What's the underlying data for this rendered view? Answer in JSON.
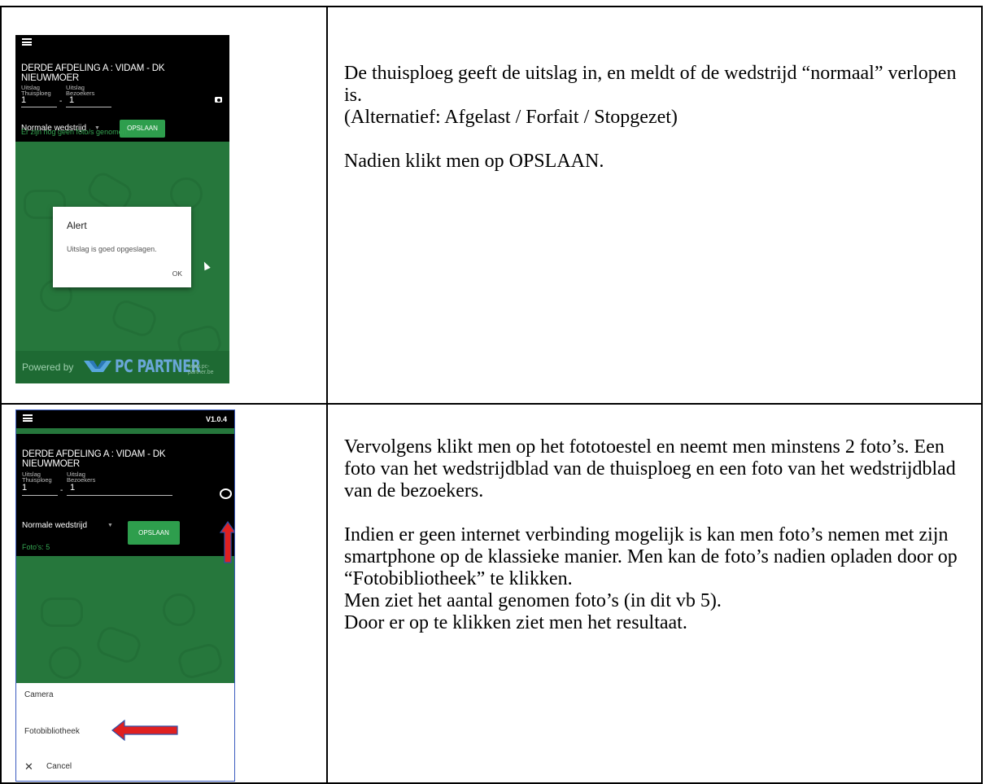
{
  "rows": [
    {
      "phone": {
        "league_title": "DERDE AFDELING A : VIDAM - DK NIEUWMOER",
        "score_label": "Uitslag",
        "home_label": "Thuisploeg",
        "away_label": "Bezoekers",
        "home_score": "1",
        "away_score": "1",
        "dash": "-",
        "match_type": "Normale wedstrijd",
        "save_label": "OPSLAAN",
        "photo_info": "Er zijn nog geen foto/s genomen",
        "alert": {
          "title": "Alert",
          "message": "Uitslag is goed opgeslagen.",
          "ok": "OK"
        },
        "footer": {
          "powered_by": "Powered by",
          "brand": "PC PARTNER",
          "url": "www.pc-partner.be"
        }
      },
      "text": {
        "line1": "De thuisploeg geeft de uitslag in, en meldt of de wedstrijd “normaal” verlopen is.",
        "line2": "(Alternatief: Afgelast / Forfait / Stopgezet)",
        "line3": "Nadien klikt men op OPSLAAN."
      }
    },
    {
      "phone": {
        "version": "V1.0.4",
        "league_title_1": "DERDE AFDELING A : VIDAM - DK",
        "league_title_2": "NIEUWMOER",
        "score_label": "Uitslag",
        "home_label": "Thuisploeg",
        "away_label": "Bezoekers",
        "home_score": "1",
        "away_score": "1",
        "dash": "-",
        "match_type": "Normale wedstrijd",
        "save_label": "OPSLAAN",
        "photo_info": "Foto's: 5",
        "sheet": {
          "camera": "Camera",
          "library": "Fotobibliotheek",
          "cancel": "Cancel"
        },
        "arrow_color": "#e02020"
      },
      "text": {
        "line1": "Vervolgens klikt men op het fototoestel en neemt men minstens 2 foto’s. Een foto van het wedstrijdblad van de thuisploeg en een foto van het wedstrijdblad van de bezoekers.",
        "line2": "Indien er geen internet verbinding mogelijk is kan men foto’s nemen met zijn smartphone op de klassieke manier. Men kan de foto’s nadien opladen door op “Fotobibliotheek” te klikken.",
        "line3": "Men ziet het aantal genomen foto’s (in dit vb 5).",
        "line4": "Door er op te klikken ziet men het resultaat."
      }
    }
  ],
  "colors": {
    "app_green": "#26773c",
    "button_green": "#2e9e4d",
    "header_black": "#000000"
  }
}
